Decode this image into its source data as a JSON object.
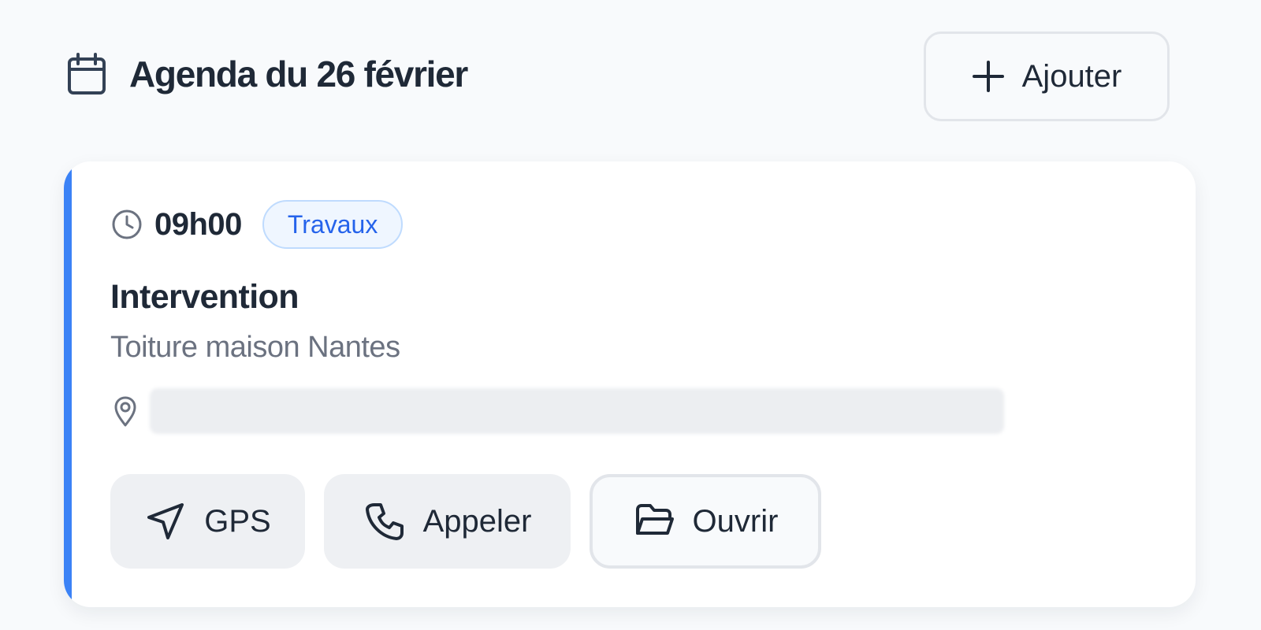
{
  "header": {
    "title": "Agenda du 26 février",
    "title_icon": "calendar-icon",
    "add_button": {
      "label": "Ajouter",
      "icon": "plus-icon"
    }
  },
  "event": {
    "accent_color": "#3b82f6",
    "time": "09h00",
    "time_icon": "clock-icon",
    "category": "Travaux",
    "title": "Intervention",
    "subtitle": "Toiture maison Nantes",
    "location_icon": "map-pin-icon",
    "actions": [
      {
        "label": "GPS",
        "icon": "navigation-arrow-icon"
      },
      {
        "label": "Appeler",
        "icon": "phone-icon"
      },
      {
        "label": "Ouvrir",
        "icon": "folder-open-icon"
      }
    ]
  }
}
